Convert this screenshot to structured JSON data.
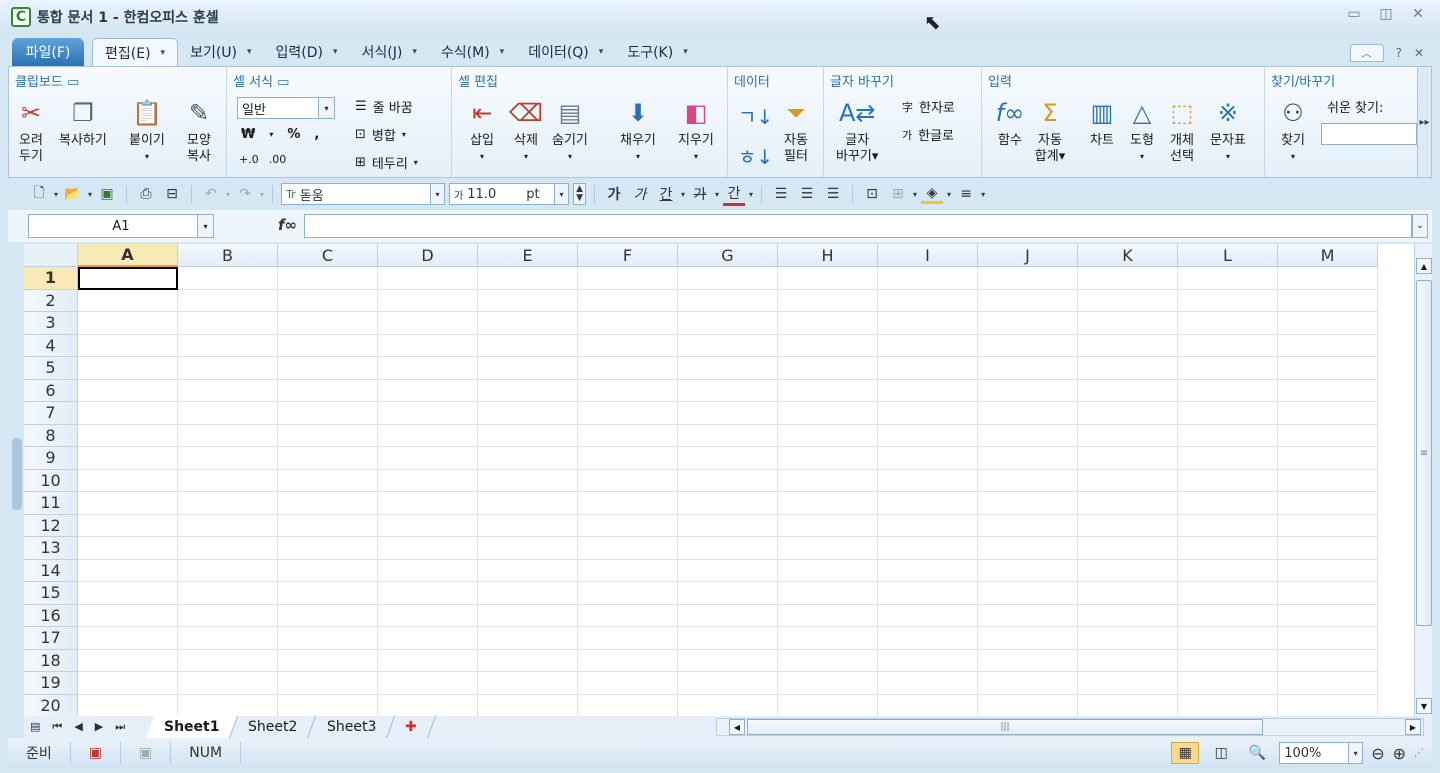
{
  "window": {
    "title": "통합 문서 1 - 한컴오피스 훈셀",
    "logo": "C"
  },
  "menu": {
    "file": "파일(F)",
    "tabs": [
      "편집(E)",
      "보기(U)",
      "입력(D)",
      "서식(J)",
      "수식(M)",
      "데이터(Q)",
      "도구(K)"
    ],
    "help": "?"
  },
  "ribbon": {
    "clipboard": {
      "title": "클립보드",
      "cut": [
        "오려",
        "두기"
      ],
      "copy": "복사하기",
      "paste": "붙이기",
      "format_copy": [
        "모양",
        "복사"
      ]
    },
    "cell_format": {
      "title": "셀 서식",
      "number_format": "일반",
      "currency": "₩",
      "percent": "%",
      "comma": ",",
      "wrap": "줄 바꿈",
      "merge": "병합",
      "border": "테두리"
    },
    "cell_edit": {
      "title": "셀 편집",
      "insert": "삽입",
      "delete": "삭제",
      "hide": "숨기기",
      "fill": "채우기",
      "clear": "지우기"
    },
    "data": {
      "title": "데이터",
      "autofilter": [
        "자동",
        "필터"
      ]
    },
    "convert": {
      "title": "글자 바꾸기",
      "convert_btn": [
        "글자",
        "바꾸기"
      ],
      "to_hanja": "한자로",
      "to_hangul": "한글로"
    },
    "input": {
      "title": "입력",
      "function": "함수",
      "autosum": [
        "자동",
        "합계"
      ],
      "chart": "차트",
      "shape": "도형",
      "select_object": [
        "개체",
        "선택"
      ],
      "symbol": "문자표"
    },
    "find": {
      "title": "찾기/바꾸기",
      "find": "찾기",
      "easy_find": "쉬운 찾기:"
    }
  },
  "toolbar": {
    "font": "돋움",
    "font_size": "11.0",
    "size_unit": "pt",
    "bold": "가",
    "italic": "가",
    "underline": "간",
    "strike": "가",
    "font_color": "간"
  },
  "formula": {
    "cell_ref": "A1",
    "fx": "f(x)",
    "value": ""
  },
  "grid": {
    "columns": [
      "A",
      "B",
      "C",
      "D",
      "E",
      "F",
      "G",
      "H",
      "I",
      "J",
      "K",
      "L",
      "M"
    ],
    "rows": [
      "1",
      "2",
      "3",
      "4",
      "5",
      "6",
      "7",
      "8",
      "9",
      "10",
      "11",
      "12",
      "13",
      "14",
      "15",
      "16",
      "17",
      "18",
      "19",
      "20"
    ],
    "active_cell": "A1"
  },
  "sheets": {
    "tabs": [
      "Sheet1",
      "Sheet2",
      "Sheet3"
    ],
    "active": "Sheet1"
  },
  "status": {
    "mode": "준비",
    "num": "NUM",
    "zoom": "100%"
  },
  "colors": {
    "accent": "#2b72b4",
    "selection_header": "#f9e9b6",
    "group_title": "#2b6fb1"
  }
}
